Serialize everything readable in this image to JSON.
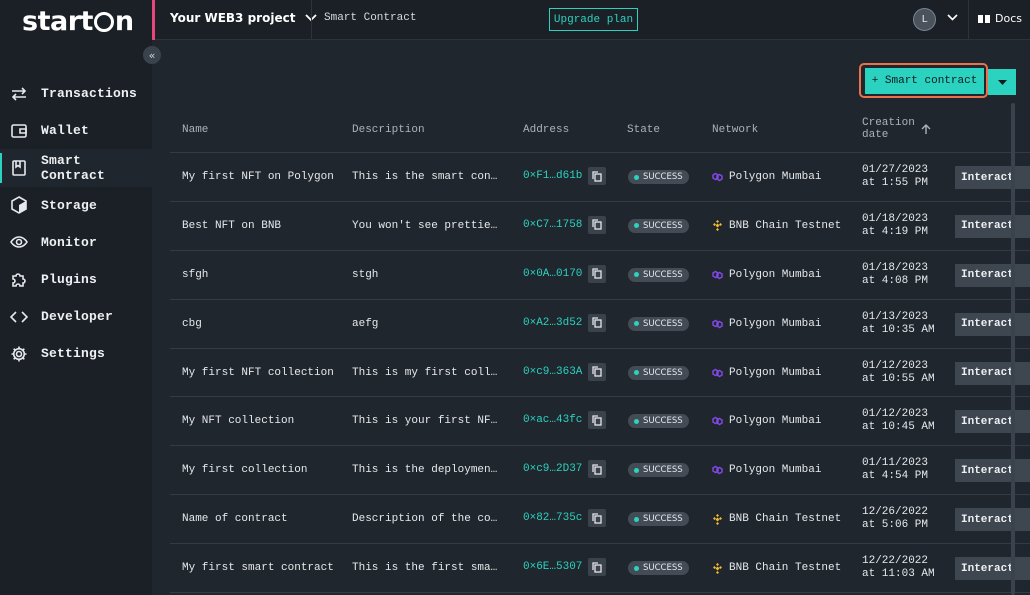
{
  "app": {
    "logo_text_1": "start",
    "logo_text_2": "n"
  },
  "topbar": {
    "project": "Your WEB3 project",
    "breadcrumb": "Smart Contract",
    "upgrade": "Upgrade plan",
    "avatar_initial": "L",
    "docs": "Docs"
  },
  "sidebar": {
    "items": [
      {
        "label": "Transactions",
        "icon": "transfer-icon"
      },
      {
        "label": "Wallet",
        "icon": "wallet-icon"
      },
      {
        "label": "Smart Contract",
        "icon": "contract-icon"
      },
      {
        "label": "Storage",
        "icon": "cube-icon"
      },
      {
        "label": "Monitor",
        "icon": "eye-icon"
      },
      {
        "label": "Plugins",
        "icon": "puzzle-icon"
      },
      {
        "label": "Developer",
        "icon": "code-icon"
      },
      {
        "label": "Settings",
        "icon": "gear-icon"
      }
    ]
  },
  "actions": {
    "add_contract": "+ Smart contract"
  },
  "table": {
    "headers": [
      "Name",
      "Description",
      "Address",
      "State",
      "Network",
      "Creation",
      "date"
    ],
    "interact_label": "Interact",
    "rows": [
      {
        "name": "My first NFT on Polygon",
        "desc": "This is the smart contract of my first NFT on Polygon",
        "addr": "0×F1…d61b",
        "state": "SUCCESS",
        "network": "Polygon Mumbai",
        "net": "polygon",
        "d1": "01/27/2023",
        "d2": "at 1:55 PM"
      },
      {
        "name": "Best NFT on BNB",
        "desc": "You won't see prettier NFT than this",
        "addr": "0×C7…1758",
        "state": "SUCCESS",
        "network": "BNB Chain Testnet",
        "net": "bnb",
        "d1": "01/18/2023",
        "d2": "at 4:19 PM"
      },
      {
        "name": "sfgh",
        "desc": "stgh",
        "addr": "0×0A…0170",
        "state": "SUCCESS",
        "network": "Polygon Mumbai",
        "net": "polygon",
        "d1": "01/18/2023",
        "d2": "at 4:08 PM"
      },
      {
        "name": "cbg",
        "desc": "aefg",
        "addr": "0×A2…3d52",
        "state": "SUCCESS",
        "network": "Polygon Mumbai",
        "net": "polygon",
        "d1": "01/13/2023",
        "d2": "at 10:35 AM"
      },
      {
        "name": "My first NFT collection",
        "desc": "This is my first collection of NFT",
        "addr": "0×c9…363A",
        "state": "SUCCESS",
        "network": "Polygon Mumbai",
        "net": "polygon",
        "d1": "01/12/2023",
        "d2": "at 10:55 AM"
      },
      {
        "name": "My NFT collection",
        "desc": "This is your first NFT collection",
        "addr": "0×ac…43fc",
        "state": "SUCCESS",
        "network": "Polygon Mumbai",
        "net": "polygon",
        "d1": "01/12/2023",
        "d2": "at 10:45 AM"
      },
      {
        "name": "My first collection",
        "desc": "This is the deployment of my first collection",
        "addr": "0×c9…2D37",
        "state": "SUCCESS",
        "network": "Polygon Mumbai",
        "net": "polygon",
        "d1": "01/11/2023",
        "d2": "at 4:54 PM"
      },
      {
        "name": "Name of contract",
        "desc": "Description of the contract",
        "addr": "0×82…735c",
        "state": "SUCCESS",
        "network": "BNB Chain Testnet",
        "net": "bnb",
        "d1": "12/26/2022",
        "d2": "at 5:06 PM"
      },
      {
        "name": "My first smart contract",
        "desc": "This is the first smart contract",
        "addr": "0×6E…5307",
        "state": "SUCCESS",
        "network": "BNB Chain Testnet",
        "net": "bnb",
        "d1": "12/22/2022",
        "d2": "at 11:03 AM"
      }
    ]
  },
  "colors": {
    "accent": "#2bd2c0",
    "sidebar_bg": "#1b2027",
    "main_bg": "#20262d",
    "highlight": "#e8734a",
    "polygon": "#8247e5",
    "bnb": "#f3ba2f"
  }
}
